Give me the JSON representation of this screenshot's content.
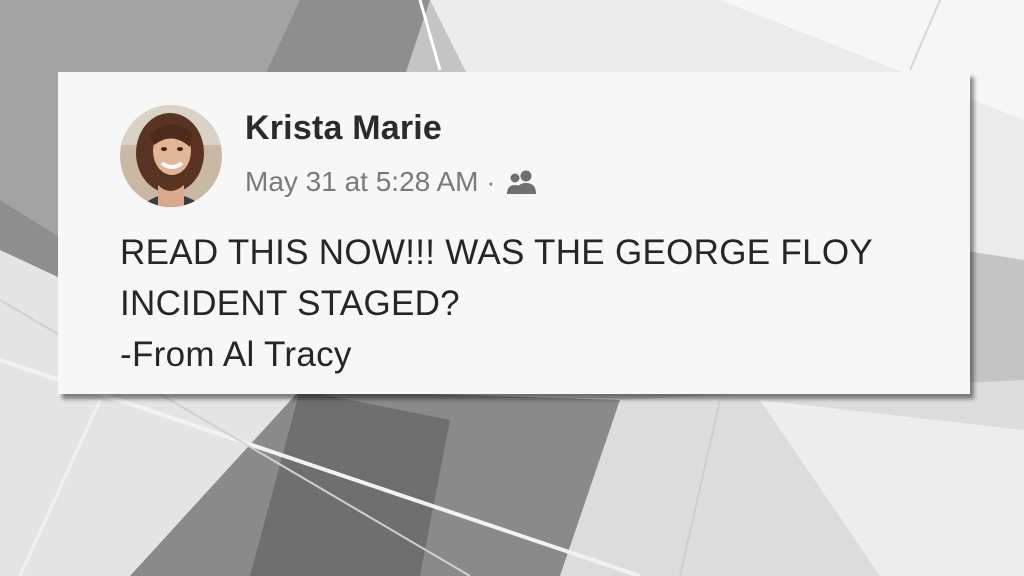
{
  "post": {
    "author_name": "Krista Marie",
    "timestamp": "May 31 at 5:28 AM",
    "separator": "·",
    "audience_icon": "friends-icon",
    "body_lines": [
      "READ THIS NOW!!! WAS THE GEORGE FLOY",
      "INCIDENT STAGED?",
      "-From Al Tracy"
    ]
  },
  "colors": {
    "card_background": "#f7f7f7",
    "author_text": "#2b2b2b",
    "meta_text": "#7a7a7a",
    "body_text": "#262626",
    "background_gray": "#bdbdbd"
  }
}
